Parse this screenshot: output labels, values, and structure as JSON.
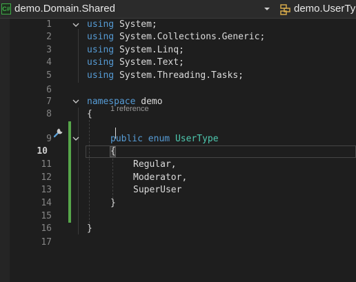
{
  "navbar": {
    "project_icon": "csharp-project-icon",
    "project_icon_text": "C#",
    "project_name": "demo.Domain.Shared",
    "dropdown_icon": "chevron-down-icon",
    "type_icon": "class-type-icon",
    "type_name": "demo.UserType"
  },
  "editor": {
    "line_numbers": [
      "1",
      "2",
      "3",
      "4",
      "5",
      "6",
      "7",
      "8",
      "9",
      "10",
      "11",
      "12",
      "13",
      "14",
      "15",
      "16",
      "17"
    ],
    "active_line": "10",
    "codelens": "1 reference",
    "lines": {
      "l1": {
        "kw": "using",
        "rest": " System;"
      },
      "l2": {
        "kw": "using",
        "rest": " System.Collections.Generic;"
      },
      "l3": {
        "kw": "using",
        "rest": " System.Linq;"
      },
      "l4": {
        "kw": "using",
        "rest": " System.Text;"
      },
      "l5": {
        "kw": "using",
        "rest": " System.Threading.Tasks;"
      },
      "l7": {
        "kw": "namespace",
        "rest": " demo"
      },
      "l8": {
        "text": "{"
      },
      "l9": {
        "kw1": "public",
        "kw2": "enum",
        "type": "UserType"
      },
      "l10": {
        "text": "{"
      },
      "l11": {
        "text": "Regular,"
      },
      "l12": {
        "text": "Moderator,"
      },
      "l13": {
        "text": "SuperUser"
      },
      "l14": {
        "text": "}"
      },
      "l16": {
        "text": "}"
      }
    },
    "colors": {
      "keyword": "#569cd6",
      "type": "#4ec9b0",
      "text": "#dcdcdc",
      "change_bar": "#57a64a"
    }
  }
}
